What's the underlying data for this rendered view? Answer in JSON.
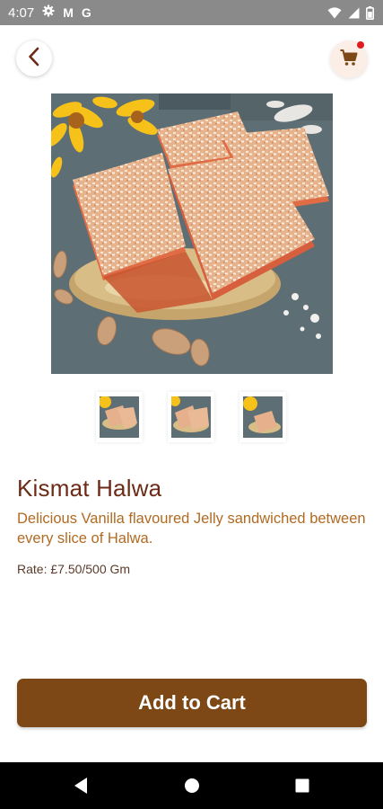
{
  "status_bar": {
    "time": "4:07",
    "left_icons": [
      "settings-icon",
      "gmail-icon",
      "google-icon"
    ],
    "gmail_glyph": "M",
    "google_glyph": "G",
    "right_icons": [
      "wifi-icon",
      "signal-icon",
      "battery-icon"
    ]
  },
  "header": {
    "back_icon": "chevron-left-icon",
    "cart_icon": "shopping-cart-icon",
    "cart_has_notification": true
  },
  "gallery": {
    "main_image": "halwa-photo",
    "thumbnail_count": 3
  },
  "product": {
    "title": "Kismat Halwa",
    "description": "Delicious Vanilla flavoured Jelly sandwiched between every slice of Halwa.",
    "rate": "Rate: £7.50/500 Gm"
  },
  "actions": {
    "add_to_cart_label": "Add to Cart"
  },
  "nav_bar": {
    "icons": [
      "back-triangle-icon",
      "home-circle-icon",
      "recents-square-icon"
    ]
  },
  "colors": {
    "brand_brown": "#7d4816",
    "title_brown": "#6b2b16",
    "description_amber": "#b06a22",
    "cart_badge_red": "#e01b1b"
  }
}
